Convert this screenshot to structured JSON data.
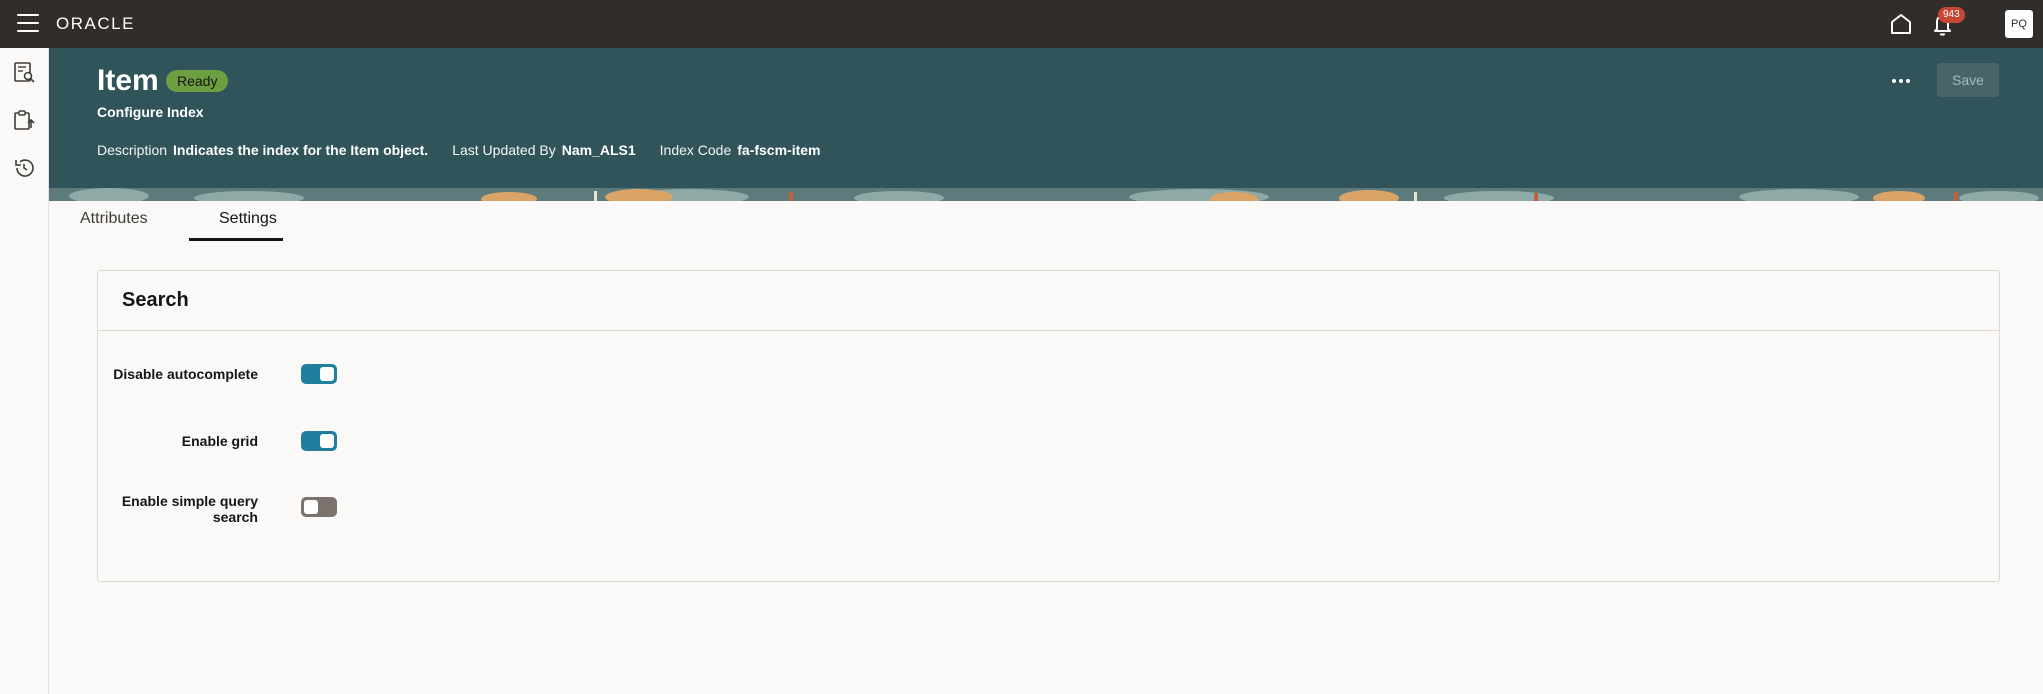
{
  "topbar": {
    "logo": "ORACLE",
    "notification_count": "943",
    "user_initials": "PQ"
  },
  "header": {
    "title": "Item",
    "status": "Ready",
    "subtitle": "Configure Index",
    "meta": {
      "description_label": "Description",
      "description_value": "Indicates the index for the Item object.",
      "updated_label": "Last Updated By",
      "updated_value": "Nam_ALS1",
      "code_label": "Index Code",
      "code_value": "fa-fscm-item"
    },
    "save_label": "Save"
  },
  "tabs": [
    {
      "label": "Attributes"
    },
    {
      "label": "Settings"
    }
  ],
  "active_tab": "Settings",
  "search_card": {
    "title": "Search",
    "settings": [
      {
        "label": "Disable autocomplete",
        "enabled": true
      },
      {
        "label": "Enable grid",
        "enabled": true
      },
      {
        "label": "Enable simple query search",
        "enabled": false
      }
    ]
  },
  "colors": {
    "topbar": "#312d2a",
    "banner": "#30545a",
    "status_badge": "#6d9e3f",
    "switch_on": "#227e9e",
    "switch_off": "#7a736e",
    "notification_badge": "#c74634"
  }
}
